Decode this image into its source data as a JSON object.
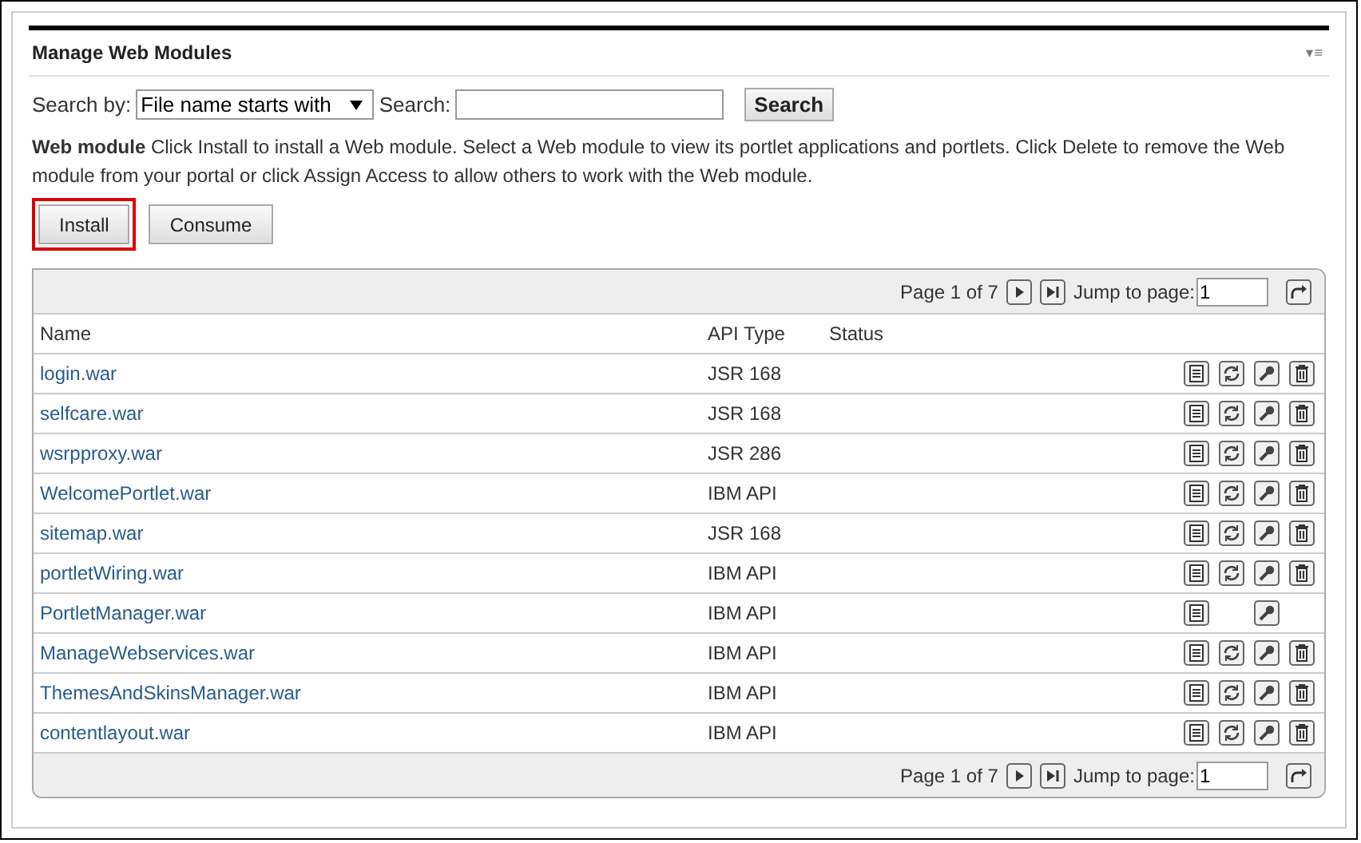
{
  "portlet": {
    "title": "Manage Web Modules",
    "menu_glyph": "▾≡"
  },
  "search": {
    "by_label": "Search by:",
    "by_value": "File name starts with",
    "search_label": "Search:",
    "button": "Search"
  },
  "description": {
    "heading": "Web module",
    "text": "Click Install to install a Web module. Select a Web module to view its portlet applications and portlets. Click Delete to remove the Web module from your portal or click Assign Access to allow others to work with the Web module."
  },
  "buttons": [
    {
      "label": "Install",
      "highlighted": true
    },
    {
      "label": "Consume",
      "highlighted": false
    }
  ],
  "pager_top": {
    "page_text": "Page 1 of 7",
    "jump_label": "Jump to page:",
    "jump_value": "1"
  },
  "table": {
    "columns": [
      "Name",
      "API Type",
      "Status"
    ],
    "rows": [
      {
        "name": "login.war",
        "api": "JSR 168",
        "can_update": true,
        "can_delete": true
      },
      {
        "name": "selfcare.war",
        "api": "JSR 168",
        "can_update": true,
        "can_delete": true
      },
      {
        "name": "wsrpproxy.war",
        "api": "JSR 286",
        "can_update": true,
        "can_delete": true
      },
      {
        "name": "WelcomePortlet.war",
        "api": "IBM API",
        "can_update": true,
        "can_delete": true
      },
      {
        "name": "sitemap.war",
        "api": "JSR 168",
        "can_update": true,
        "can_delete": true
      },
      {
        "name": "portletWiring.war",
        "api": "IBM API",
        "can_update": true,
        "can_delete": true
      },
      {
        "name": "PortletManager.war",
        "api": "IBM API",
        "can_update": false,
        "can_delete": false
      },
      {
        "name": "ManageWebservices.war",
        "api": "IBM API",
        "can_update": true,
        "can_delete": true
      },
      {
        "name": "ThemesAndSkinsManager.war",
        "api": "IBM API",
        "can_update": true,
        "can_delete": true
      },
      {
        "name": "contentlayout.war",
        "api": "IBM API",
        "can_update": true,
        "can_delete": true
      }
    ]
  },
  "pager_bottom": {
    "page_text": "Page 1 of 7",
    "jump_label": "Jump to page:",
    "jump_value": "1"
  }
}
